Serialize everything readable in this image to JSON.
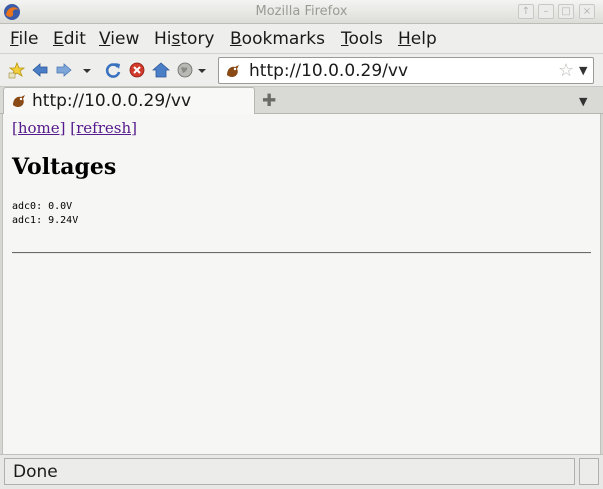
{
  "window": {
    "title": "Mozilla Firefox",
    "buttons": [
      "↑",
      "–",
      "□",
      "×"
    ]
  },
  "menubar": {
    "items": [
      {
        "label": "File",
        "u": "F",
        "rest": "ile"
      },
      {
        "label": "Edit",
        "u": "E",
        "rest": "dit"
      },
      {
        "label": "View",
        "u": "V",
        "rest": "iew"
      },
      {
        "label": "History",
        "pre": "Hi",
        "u": "s",
        "rest": "tory"
      },
      {
        "label": "Bookmarks",
        "u": "B",
        "rest": "ookmarks"
      },
      {
        "label": "Tools",
        "u": "T",
        "rest": "ools"
      },
      {
        "label": "Help",
        "u": "H",
        "rest": "elp"
      }
    ]
  },
  "navbar": {
    "url": "http://10.0.0.29/vv",
    "star": "☆",
    "dropdown": "▼",
    "icons": [
      "new-bookmark-icon",
      "back-icon",
      "forward-icon",
      "history-dropdown-icon",
      "reload-icon",
      "stop-icon",
      "home-icon",
      "globe-icon"
    ]
  },
  "tabs": {
    "items": [
      {
        "label": "http://10.0.0.29/vv"
      }
    ],
    "new_tab": "✚",
    "list": "▼"
  },
  "page": {
    "links": [
      "[home]",
      "[refresh]"
    ],
    "title": "Voltages",
    "readings": [
      "adc0: 0.0V",
      "adc1: 9.24V"
    ]
  },
  "status": {
    "text": "Done"
  },
  "colors": {
    "link_visited": "#551a8b",
    "chrome": "#eeeeec",
    "content_bg": "#f6f6f4"
  }
}
